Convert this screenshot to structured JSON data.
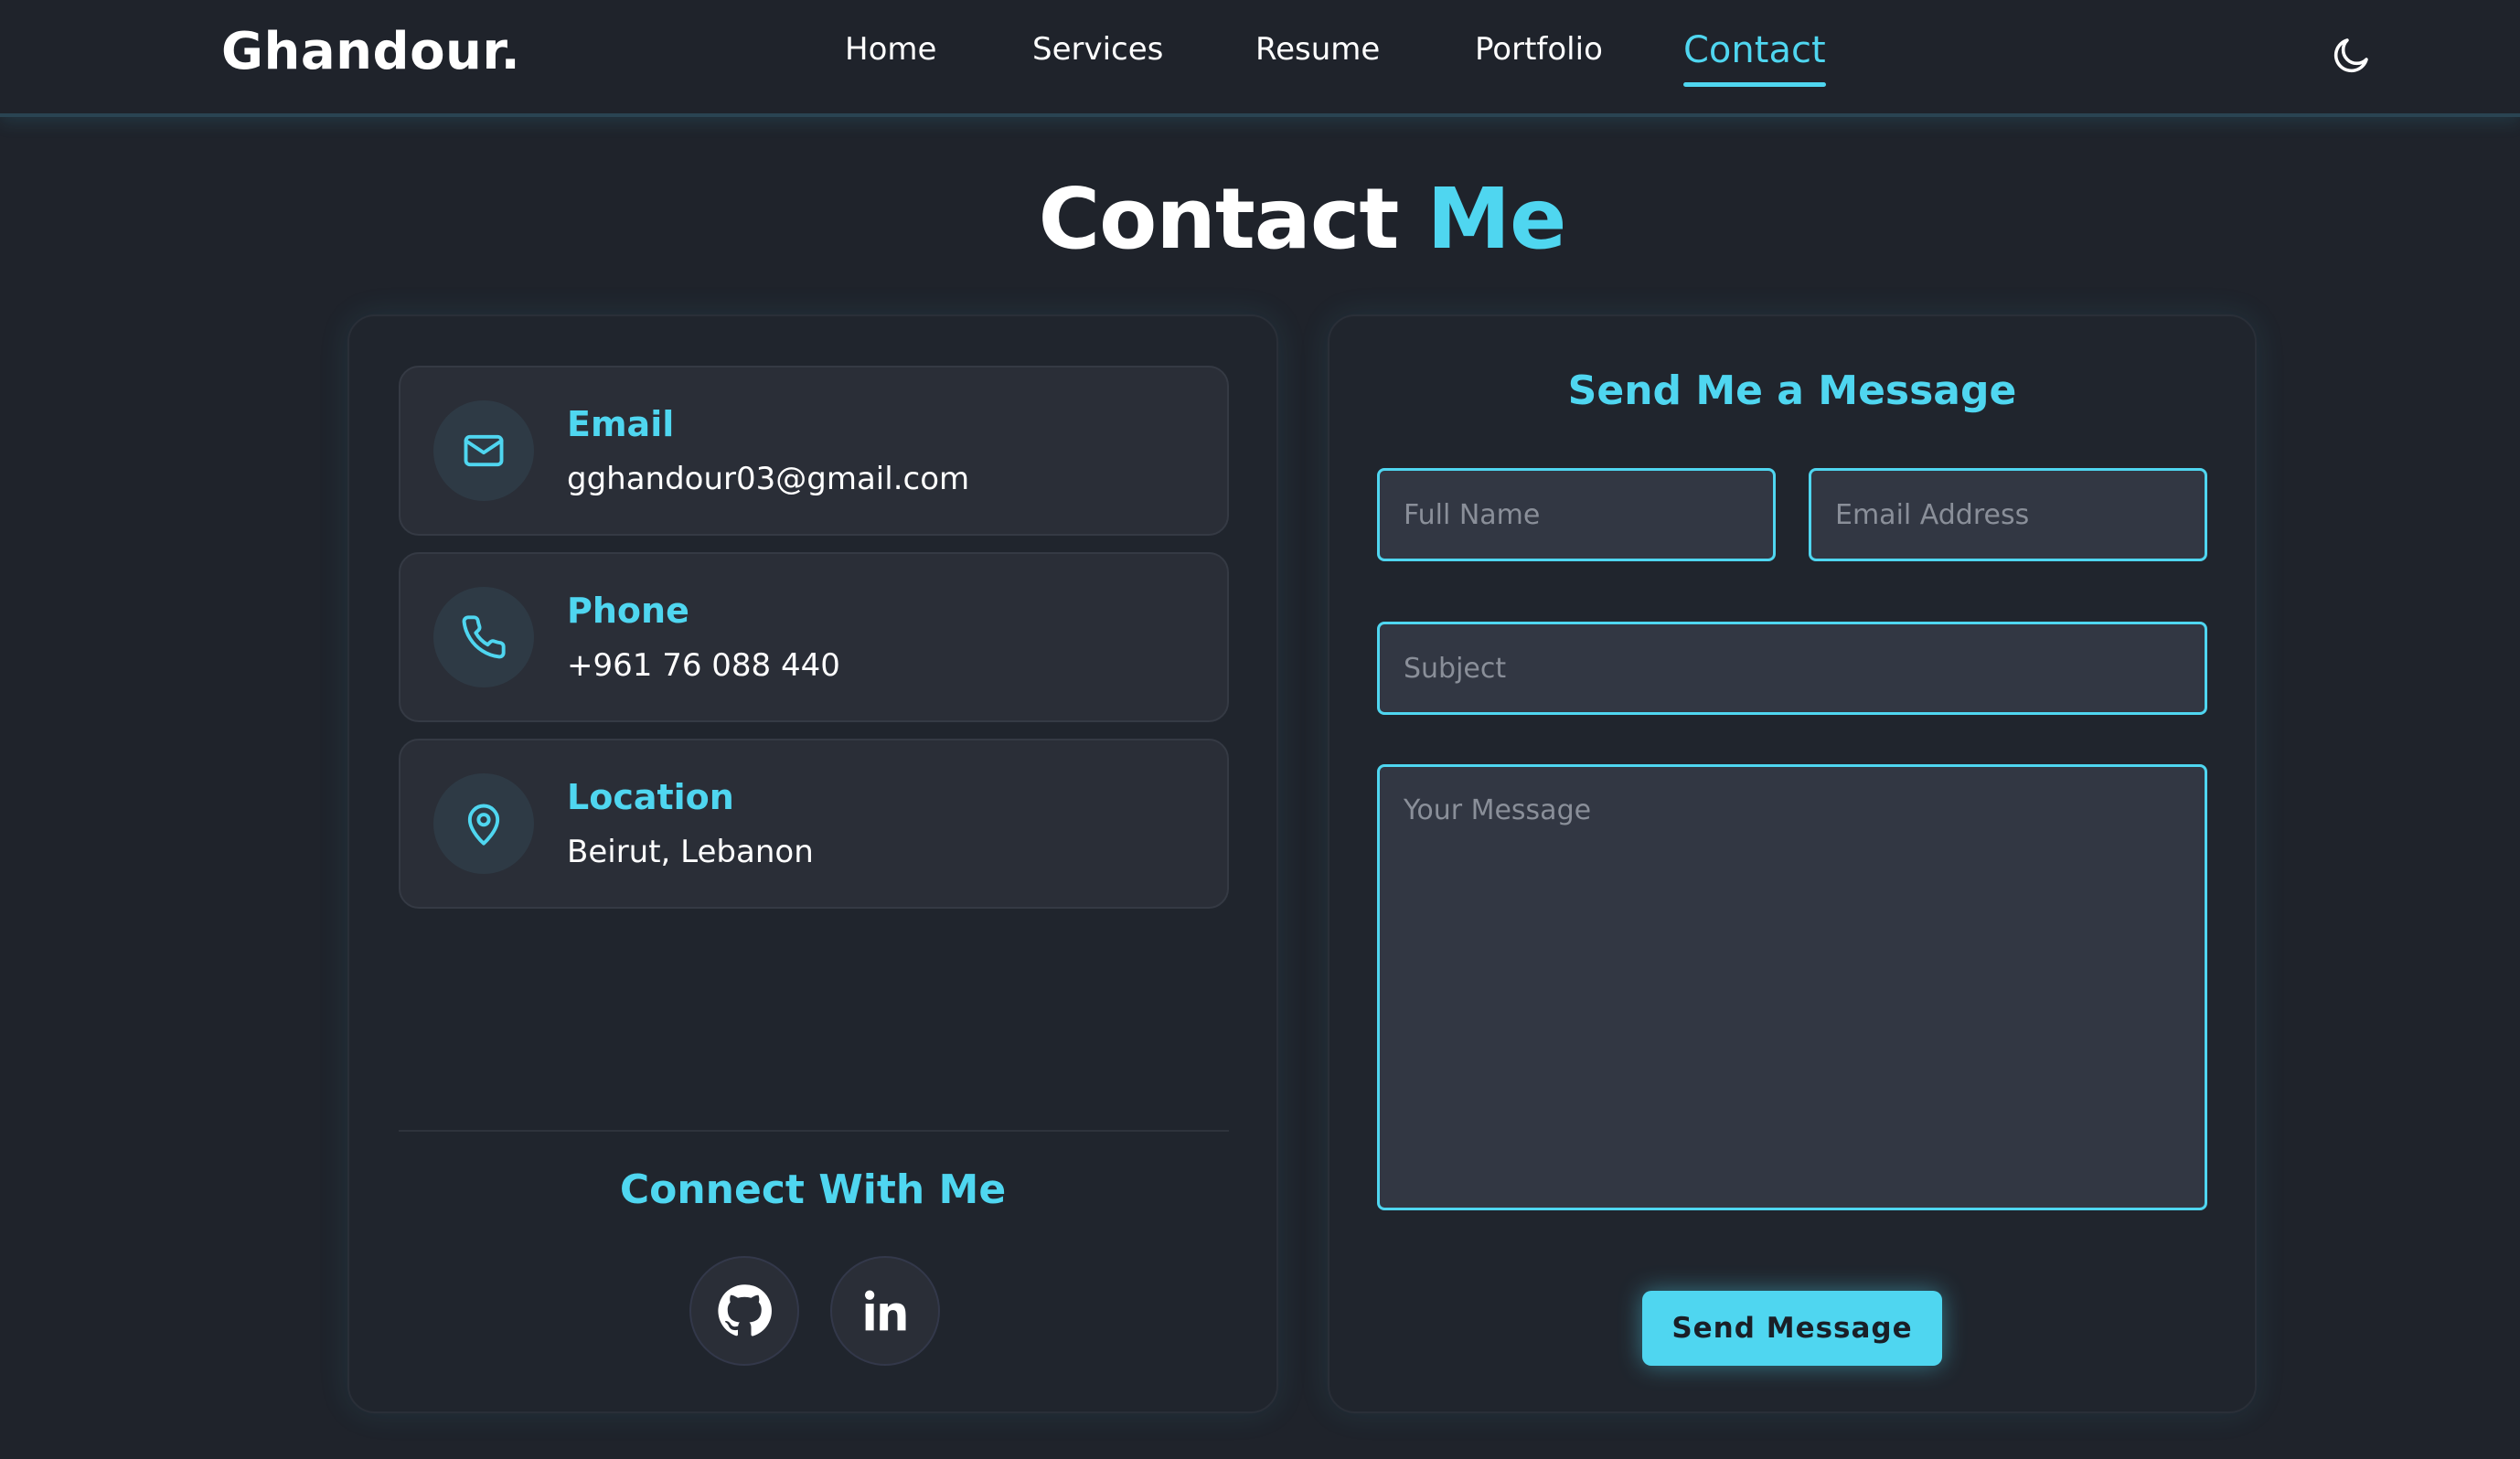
{
  "navbar": {
    "logo": "Ghandour.",
    "links": [
      "Home",
      "Services",
      "Resume",
      "Portfolio",
      "Contact"
    ],
    "active_link": "Contact",
    "theme_toggle_icon": "moon-icon"
  },
  "title": {
    "main": "Contact",
    "accent": "Me"
  },
  "contact_info": {
    "items": [
      {
        "icon": "mail-icon",
        "title": "Email",
        "value": "gghandour03@gmail.com"
      },
      {
        "icon": "phone-icon",
        "title": "Phone",
        "value": "+961 76 088 440"
      },
      {
        "icon": "location-pin-icon",
        "title": "Location",
        "value": "Beirut, Lebanon"
      }
    ],
    "connect_title": "Connect With Me",
    "socials": [
      {
        "icon": "github-icon",
        "name": "GitHub"
      },
      {
        "icon": "linkedin-icon",
        "name": "LinkedIn"
      }
    ]
  },
  "form": {
    "title": "Send Me a Message",
    "full_name_placeholder": "Full Name",
    "email_placeholder": "Email Address",
    "subject_placeholder": "Subject",
    "message_placeholder": "Your Message",
    "submit_label": "Send Message"
  },
  "colors": {
    "accent": "#4fd6f0",
    "background": "#1f232b",
    "card": "#20252d",
    "field": "#323743"
  }
}
